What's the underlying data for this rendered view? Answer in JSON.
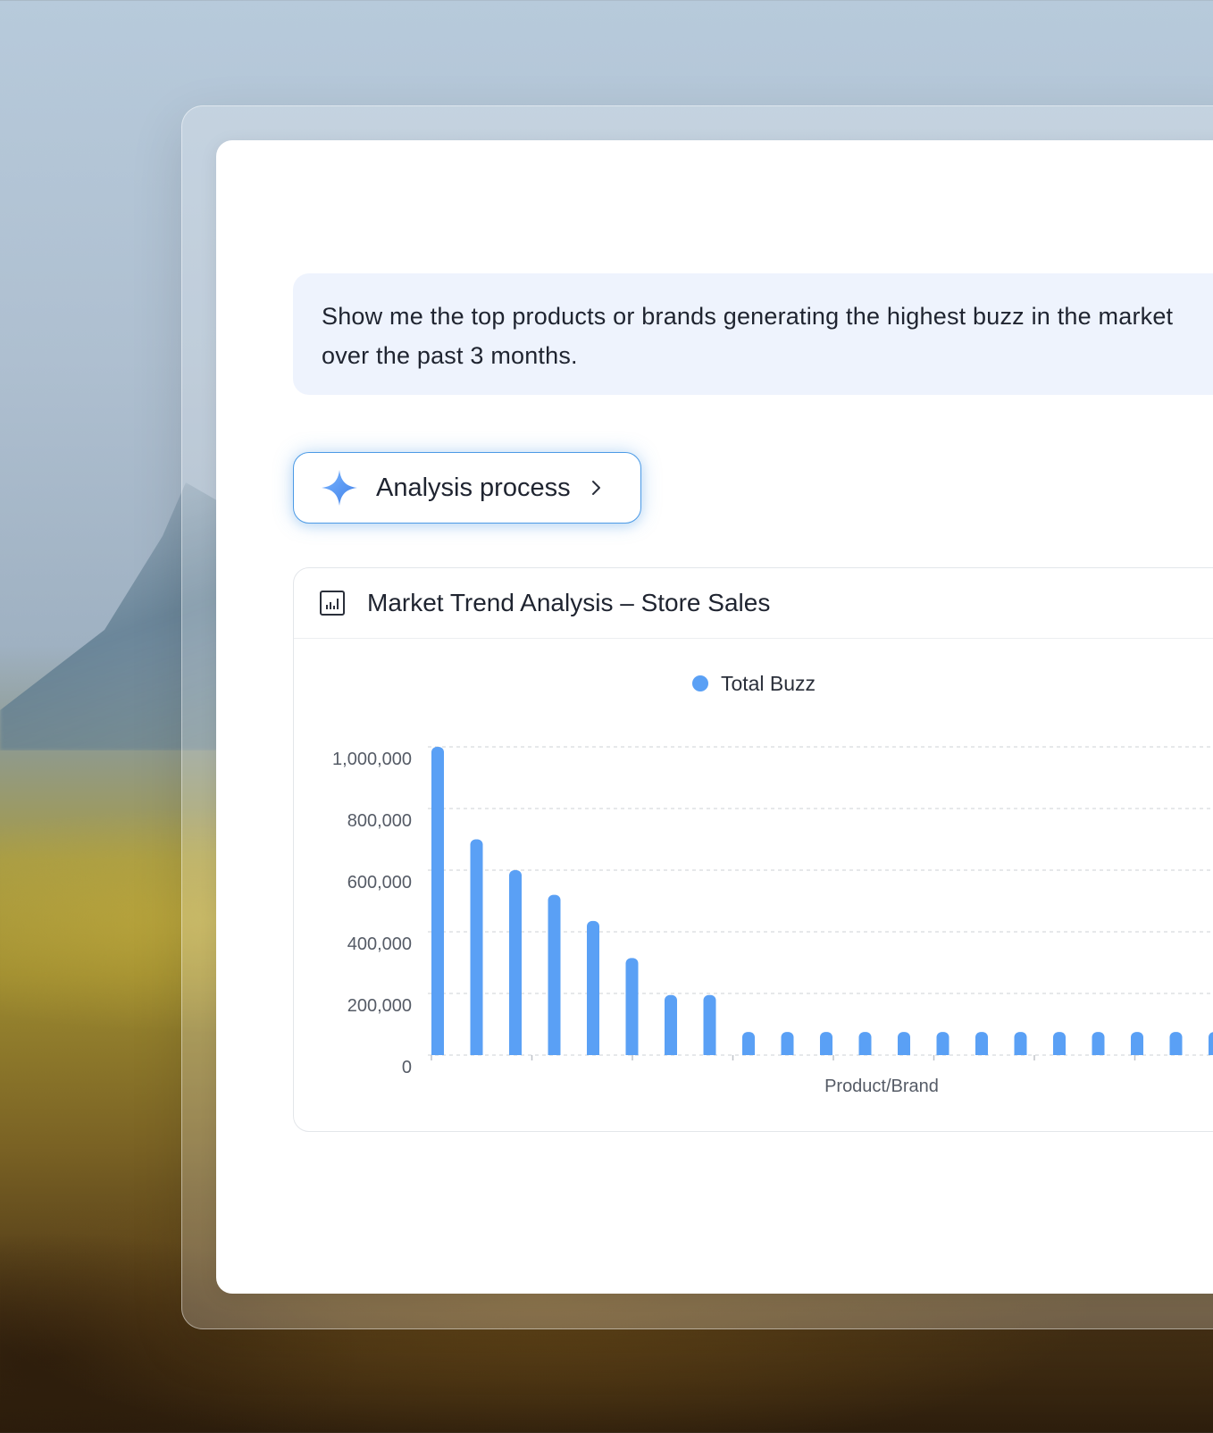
{
  "prompt": {
    "text": "Show me the top products or brands generating the highest buzz in the market over the past 3 months."
  },
  "analysis_button": {
    "label": "Analysis process",
    "icon": "sparkle-icon",
    "chevron_icon": "chevron-right-icon"
  },
  "chart_card": {
    "title": "Market Trend Analysis – Store Sales",
    "icon": "bar-chart-icon"
  },
  "colors": {
    "accent": "#5aa0f5",
    "grid": "#d6d9de",
    "text": "#1f2430",
    "muted": "#555b66"
  },
  "chart_data": {
    "type": "bar",
    "title": "",
    "xlabel": "Product/Brand",
    "ylabel": "",
    "ylim": [
      0,
      1000000
    ],
    "y_ticks": [
      "1,000,000",
      "800,000",
      "600,000",
      "400,000",
      "200,000",
      "0"
    ],
    "y_tick_values": [
      1000000,
      800000,
      600000,
      400000,
      200000,
      0
    ],
    "grid": true,
    "legend": "top-center",
    "series": [
      {
        "name": "Total Buzz",
        "color": "#5aa0f5",
        "values": [
          1000000,
          700000,
          600000,
          520000,
          435000,
          315000,
          195000,
          195000,
          75000,
          75000,
          75000,
          75000,
          75000,
          75000,
          75000,
          75000,
          75000,
          75000,
          75000,
          75000,
          75000
        ]
      }
    ]
  }
}
